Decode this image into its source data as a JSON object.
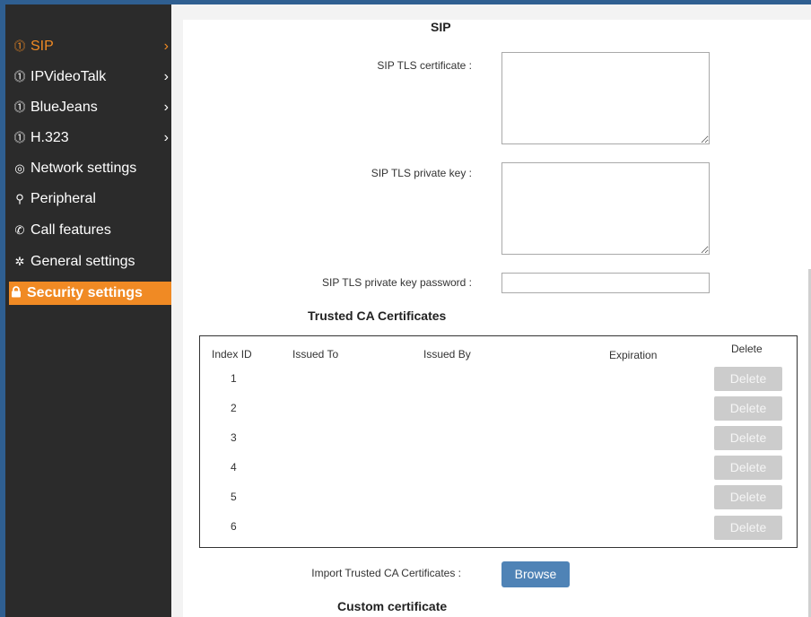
{
  "sidebar": {
    "items": [
      {
        "label": "SIP",
        "icon": "user-circle-icon",
        "glyph": "⓵",
        "chevron": "›"
      },
      {
        "label": "IPVideoTalk",
        "icon": "user-circle-icon",
        "glyph": "⓵",
        "chevron": "›"
      },
      {
        "label": "BlueJeans",
        "icon": "user-circle-icon",
        "glyph": "⓵",
        "chevron": "›"
      },
      {
        "label": "H.323",
        "icon": "user-circle-icon",
        "glyph": "⓵",
        "chevron": "›"
      },
      {
        "label": "Network settings",
        "icon": "globe-icon",
        "glyph": "◎"
      },
      {
        "label": "Peripheral",
        "icon": "peripheral-icon",
        "glyph": "⚲"
      },
      {
        "label": "Call features",
        "icon": "phone-icon",
        "glyph": "✆"
      },
      {
        "label": "General settings",
        "icon": "gear-icon",
        "glyph": "✲"
      },
      {
        "label": "Security settings",
        "icon": "lock-icon",
        "glyph": "🔒"
      }
    ]
  },
  "main": {
    "sip_title": "SIP",
    "tls_certificate_label": "SIP TLS certificate :",
    "tls_private_key_label": "SIP TLS private key :",
    "tls_key_password_label": "SIP TLS private key password :",
    "trusted_ca_title": "Trusted CA Certificates",
    "import_label": "Import Trusted CA Certificates :",
    "browse_label": "Browse",
    "custom_certificate_title": "Custom certificate"
  },
  "ca_table": {
    "columns": [
      "Index ID",
      "Issued To",
      "Issued By",
      "Expiration",
      "Delete"
    ],
    "rows": [
      {
        "index": "1",
        "delete_label": "Delete"
      },
      {
        "index": "2",
        "delete_label": "Delete"
      },
      {
        "index": "3",
        "delete_label": "Delete"
      },
      {
        "index": "4",
        "delete_label": "Delete"
      },
      {
        "index": "5",
        "delete_label": "Delete"
      },
      {
        "index": "6",
        "delete_label": "Delete"
      }
    ]
  },
  "colors": {
    "sidebar_bg": "#2b2b2b",
    "accent_orange": "#f08a24",
    "browse_blue": "#4f83b6",
    "disabled_button": "#cccccc"
  }
}
